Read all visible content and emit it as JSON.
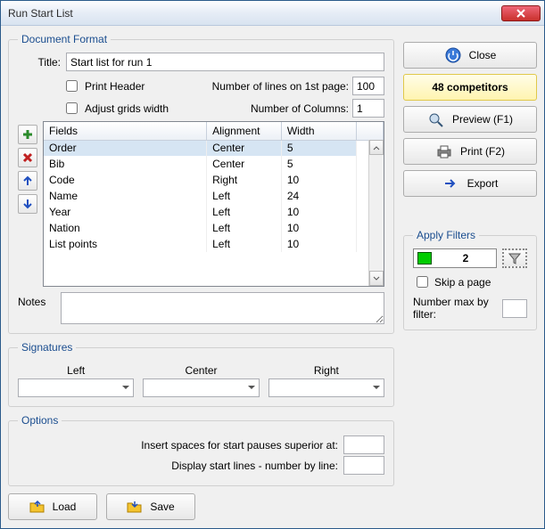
{
  "window": {
    "title": "Run Start List"
  },
  "doc_format": {
    "legend": "Document Format",
    "title_label": "Title:",
    "title_value": "Start list for run 1",
    "print_header_label": "Print Header",
    "adjust_grids_label": "Adjust grids width",
    "lines_first_page_label": "Number of lines on 1st page:",
    "lines_first_page_value": "100",
    "num_columns_label": "Number of Columns:",
    "num_columns_value": "1",
    "notes_label": "Notes",
    "table": {
      "headers": [
        "Fields",
        "Alignment",
        "Width"
      ],
      "rows": [
        {
          "field": "Order",
          "align": "Center",
          "width": "5",
          "selected": true
        },
        {
          "field": "Bib",
          "align": "Center",
          "width": "5"
        },
        {
          "field": "Code",
          "align": "Right",
          "width": "10"
        },
        {
          "field": "Name",
          "align": "Left",
          "width": "24"
        },
        {
          "field": "Year",
          "align": "Left",
          "width": "10"
        },
        {
          "field": "Nation",
          "align": "Left",
          "width": "10"
        },
        {
          "field": "List points",
          "align": "Left",
          "width": "10"
        }
      ]
    }
  },
  "signatures": {
    "legend": "Signatures",
    "left": "Left",
    "center": "Center",
    "right": "Right"
  },
  "options": {
    "legend": "Options",
    "insert_spaces_label": "Insert spaces for start pauses superior at:",
    "display_lines_label": "Display start lines - number by line:"
  },
  "buttons": {
    "load": "Load",
    "save": "Save",
    "close": "Close",
    "competitors": "48 competitors",
    "preview": "Preview (F1)",
    "print": "Print (F2)",
    "export": "Export"
  },
  "filters": {
    "legend": "Apply Filters",
    "count": "2",
    "skip_page_label": "Skip a page",
    "max_label": "Number max by filter:"
  }
}
